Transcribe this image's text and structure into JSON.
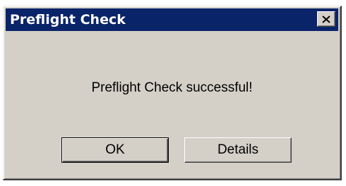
{
  "window": {
    "title": "Preflight Check",
    "close_icon": "close-icon"
  },
  "body": {
    "message": "Preflight Check successful!"
  },
  "buttons": {
    "ok_label": "OK",
    "details_label": "Details"
  },
  "colors": {
    "titlebar": "#0a246a",
    "dialog_face": "#d4d0c8",
    "title_text": "#ffffff"
  }
}
